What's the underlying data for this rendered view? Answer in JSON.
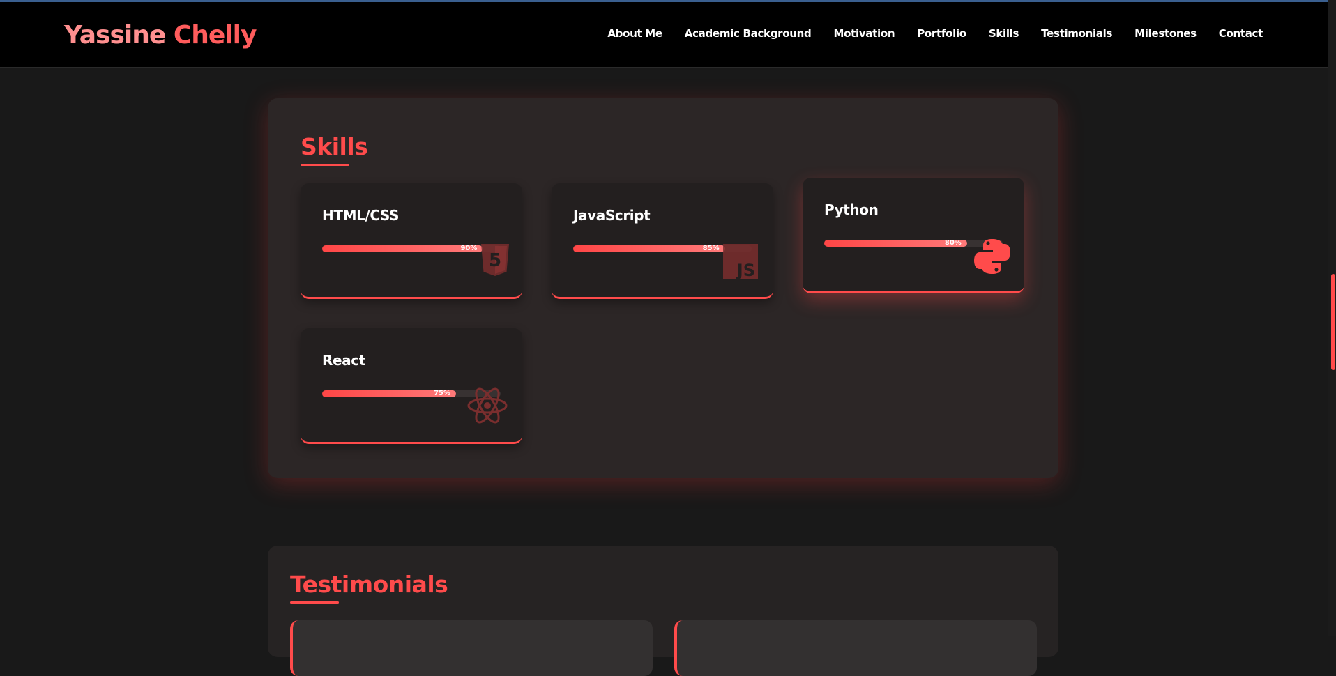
{
  "header": {
    "brand_first": "Yassine",
    "brand_last": "Chelly",
    "nav": [
      {
        "label": "About Me"
      },
      {
        "label": "Academic Background"
      },
      {
        "label": "Motivation"
      },
      {
        "label": "Portfolio"
      },
      {
        "label": "Skills"
      },
      {
        "label": "Testimonials"
      },
      {
        "label": "Milestones"
      },
      {
        "label": "Contact"
      }
    ]
  },
  "skills": {
    "title": "Skills",
    "items": [
      {
        "name": "HTML/CSS",
        "percent": 90,
        "percent_label": "90%",
        "icon": "html5-icon"
      },
      {
        "name": "JavaScript",
        "percent": 85,
        "percent_label": "85%",
        "icon": "javascript-icon"
      },
      {
        "name": "Python",
        "percent": 80,
        "percent_label": "80%",
        "icon": "python-icon"
      },
      {
        "name": "React",
        "percent": 75,
        "percent_label": "75%",
        "icon": "react-icon"
      }
    ]
  },
  "testimonials": {
    "title": "Testimonials"
  },
  "colors": {
    "accent": "#ff4b4b",
    "brand_first": "#ff8f8f",
    "background": "#191919",
    "card": "#231f1f"
  }
}
